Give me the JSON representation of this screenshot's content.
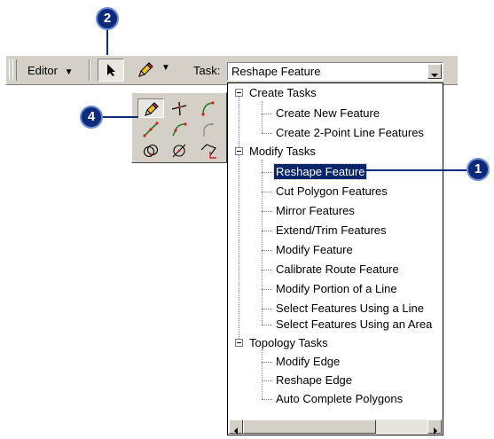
{
  "toolbar": {
    "editor_label": "Editor",
    "task_label": "Task:",
    "task_value": "Reshape Feature"
  },
  "tree": {
    "create_tasks": {
      "label": "Create Tasks",
      "items": [
        "Create New Feature",
        "Create 2-Point Line Features"
      ]
    },
    "modify_tasks": {
      "label": "Modify Tasks",
      "items": [
        "Reshape Feature",
        "Cut Polygon Features",
        "Mirror Features",
        "Extend/Trim Features",
        "Modify Feature",
        "Calibrate Route Feature",
        "Modify Portion of a Line",
        "Select Features Using a Line",
        "Select Features Using an Area"
      ]
    },
    "topology_tasks": {
      "label": "Topology Tasks",
      "items": [
        "Modify Edge",
        "Reshape Edge",
        "Auto Complete Polygons"
      ]
    },
    "selected": "Reshape Feature"
  },
  "palette": {
    "tools": [
      "sketch-tool-icon",
      "intersection-tool-icon",
      "arc-tool-icon",
      "midpoint-tool-icon",
      "tangent-arc-tool-icon",
      "endpoint-arc-tool-icon",
      "distance-distance-tool-icon",
      "direction-direction-tool-icon",
      "trace-tool-icon"
    ]
  },
  "callouts": {
    "one": "1",
    "two": "2",
    "four": "4"
  },
  "colors": {
    "callout": "#0d2b7a",
    "selection": "#0a246a",
    "chrome": "#d4d0c8"
  }
}
